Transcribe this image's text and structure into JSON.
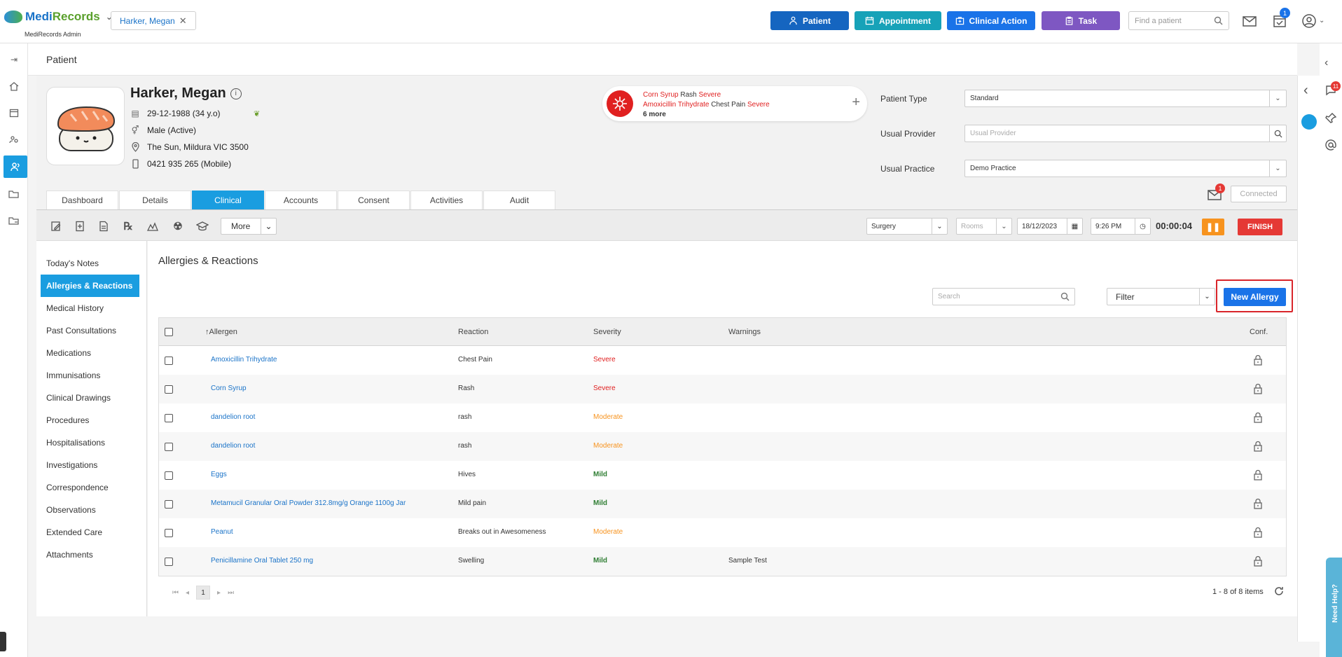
{
  "app": {
    "brand_a": "Medi",
    "brand_b": "Records",
    "sub": "MediRecords Admin"
  },
  "patient_chip": "Harker, Megan",
  "topbar": {
    "patient_btn": "Patient",
    "appointment_btn": "Appointment",
    "clinical_btn": "Clinical Action",
    "task_btn": "Task",
    "find_placeholder": "Find a patient",
    "task_count": "1",
    "colors": {
      "patient": "#1565c0",
      "appointment": "#17a2b8",
      "clinical": "#1a73e8",
      "task": "#7e57c2"
    }
  },
  "breadcrumb": "Patient",
  "patient": {
    "name": "Harker, Megan",
    "dob": "29-12-1988 (34 y.o)",
    "gender": "Male (Active)",
    "address": "The Sun, Mildura VIC 3500",
    "phone": "0421 935 265 (Mobile)"
  },
  "allergy_summary": {
    "a1_allergen": "Corn Syrup",
    "a1_reaction": "Rash",
    "a1_sev": "Severe",
    "a2_allergen": "Amoxicillin Trihydrate",
    "a2_reaction": "Chest Pain",
    "a2_sev": "Severe",
    "more": "6 more"
  },
  "fields": {
    "patient_type_label": "Patient Type",
    "patient_type": "Standard",
    "usual_provider_label": "Usual Provider",
    "usual_provider_ph": "Usual Provider",
    "usual_practice_label": "Usual Practice",
    "usual_practice": "Demo Practice"
  },
  "message_count": "1",
  "connected": "Connected",
  "tabs": [
    "Dashboard",
    "Details",
    "Clinical",
    "Accounts",
    "Consent",
    "Activities",
    "Audit"
  ],
  "toolbar": {
    "more": "More",
    "surgery": "Surgery",
    "rooms": "Rooms",
    "date": "18/12/2023",
    "time": "9:26 PM",
    "timer": "00:00:04",
    "finish": "FINISH"
  },
  "sidenav": [
    "Today's Notes",
    "Allergies & Reactions",
    "Medical History",
    "Past Consultations",
    "Medications",
    "Immunisations",
    "Clinical Drawings",
    "Procedures",
    "Hospitalisations",
    "Investigations",
    "Correspondence",
    "Observations",
    "Extended Care",
    "Attachments"
  ],
  "section_title": "Allergies & Reactions",
  "search_placeholder": "Search",
  "filter": "Filter",
  "new_allergy": "New Allergy",
  "columns": {
    "allergen": "Allergen",
    "reaction": "Reaction",
    "severity": "Severity",
    "warnings": "Warnings",
    "conf": "Conf."
  },
  "rows": [
    {
      "allergen": "Amoxicillin Trihydrate",
      "reaction": "Chest Pain",
      "severity": "Severe",
      "warnings": ""
    },
    {
      "allergen": "Corn Syrup",
      "reaction": "Rash",
      "severity": "Severe",
      "warnings": ""
    },
    {
      "allergen": "dandelion root",
      "reaction": "rash",
      "severity": "Moderate",
      "warnings": ""
    },
    {
      "allergen": "dandelion root",
      "reaction": "rash",
      "severity": "Moderate",
      "warnings": ""
    },
    {
      "allergen": "Eggs",
      "reaction": "Hives",
      "severity": "Mild",
      "warnings": ""
    },
    {
      "allergen": "Metamucil Granular Oral Powder 312.8mg/g Orange 1100g Jar",
      "reaction": "Mild pain",
      "severity": "Mild",
      "warnings": ""
    },
    {
      "allergen": "Peanut",
      "reaction": "Breaks out in Awesomeness",
      "severity": "Moderate",
      "warnings": ""
    },
    {
      "allergen": "Penicillamine Oral Tablet 250 mg",
      "reaction": "Swelling",
      "severity": "Mild",
      "warnings": "Sample Test"
    }
  ],
  "pager": {
    "page": "1",
    "items": "1 - 8 of 8 items"
  },
  "right_rail": {
    "notif_count": "11"
  },
  "help": "Need Help?"
}
